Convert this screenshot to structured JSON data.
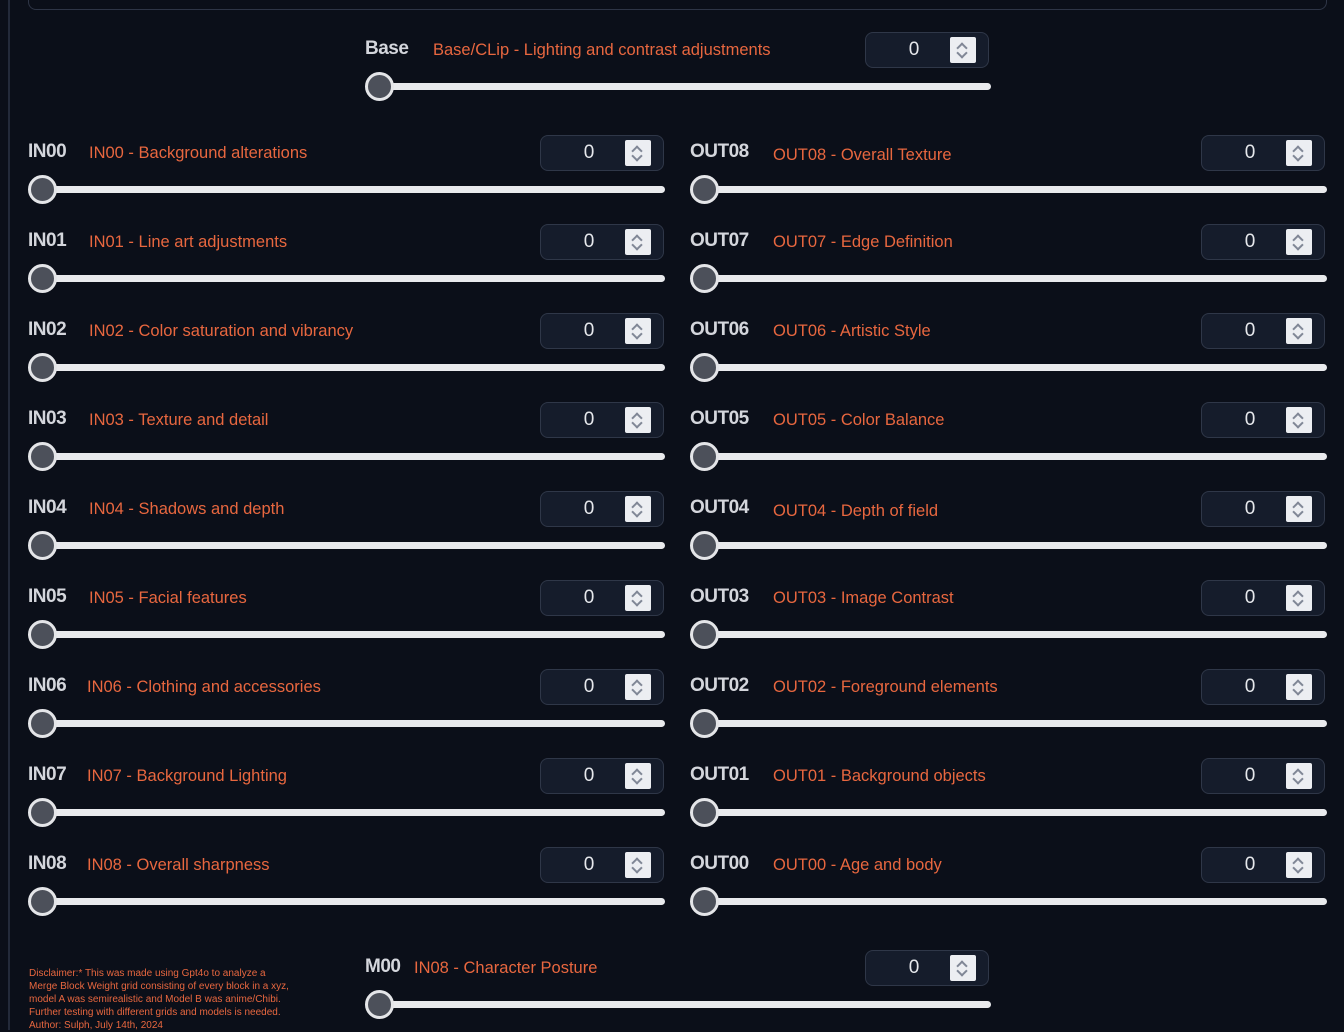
{
  "base": {
    "name": "Base",
    "description": "Base/CLip - Lighting and contrast adjustments",
    "value": "0"
  },
  "in_blocks": [
    {
      "name": "IN00",
      "description": "IN00 - Background alterations",
      "value": "0"
    },
    {
      "name": "IN01",
      "description": "IN01 - Line art adjustments",
      "value": "0"
    },
    {
      "name": "IN02",
      "description": "IN02 - Color saturation and vibrancy",
      "value": "0"
    },
    {
      "name": "IN03",
      "description": "IN03 - Texture and detail",
      "value": "0"
    },
    {
      "name": "IN04",
      "description": "IN04 - Shadows and depth",
      "value": "0"
    },
    {
      "name": "IN05",
      "description": "IN05 - Facial features",
      "value": "0"
    },
    {
      "name": "IN06",
      "description": "IN06 - Clothing and accessories",
      "value": "0"
    },
    {
      "name": "IN07",
      "description": "IN07 - Background Lighting",
      "value": "0"
    },
    {
      "name": "IN08",
      "description": "IN08 - Overall sharpness",
      "value": "0"
    }
  ],
  "out_blocks": [
    {
      "name": "OUT08",
      "description": "OUT08 - Overall Texture",
      "value": "0"
    },
    {
      "name": "OUT07",
      "description": "OUT07 - Edge Definition",
      "value": "0"
    },
    {
      "name": "OUT06",
      "description": "OUT06 - Artistic Style",
      "value": "0"
    },
    {
      "name": "OUT05",
      "description": "OUT05 - Color Balance",
      "value": "0"
    },
    {
      "name": "OUT04",
      "description": "OUT04 - Depth of field",
      "value": "0"
    },
    {
      "name": "OUT03",
      "description": "OUT03 - Image Contrast",
      "value": "0"
    },
    {
      "name": "OUT02",
      "description": "OUT02 - Foreground elements",
      "value": "0"
    },
    {
      "name": "OUT01",
      "description": "OUT01 - Background objects",
      "value": "0"
    },
    {
      "name": "OUT00",
      "description": "OUT00 - Age and body",
      "value": "0"
    }
  ],
  "mid": {
    "name": "M00",
    "description": "IN08 - Character Posture",
    "value": "0"
  },
  "disclaimer": {
    "lines": [
      "Disclaimer:* This was made using Gpt4o to analyze a",
      "Merge Block Weight grid consisting of every block in a xyz,",
      "model A was semirealistic and Model B was anime/Chibi.",
      "Further testing with different grids and models is needed.",
      "Author: Sulph, July 14th, 2024"
    ]
  },
  "colors": {
    "background": "#0b0f19",
    "label": "#e8673f",
    "block_name": "#d4d6dc",
    "input_bg": "#151c2b",
    "slider_track": "#e9eaed"
  }
}
